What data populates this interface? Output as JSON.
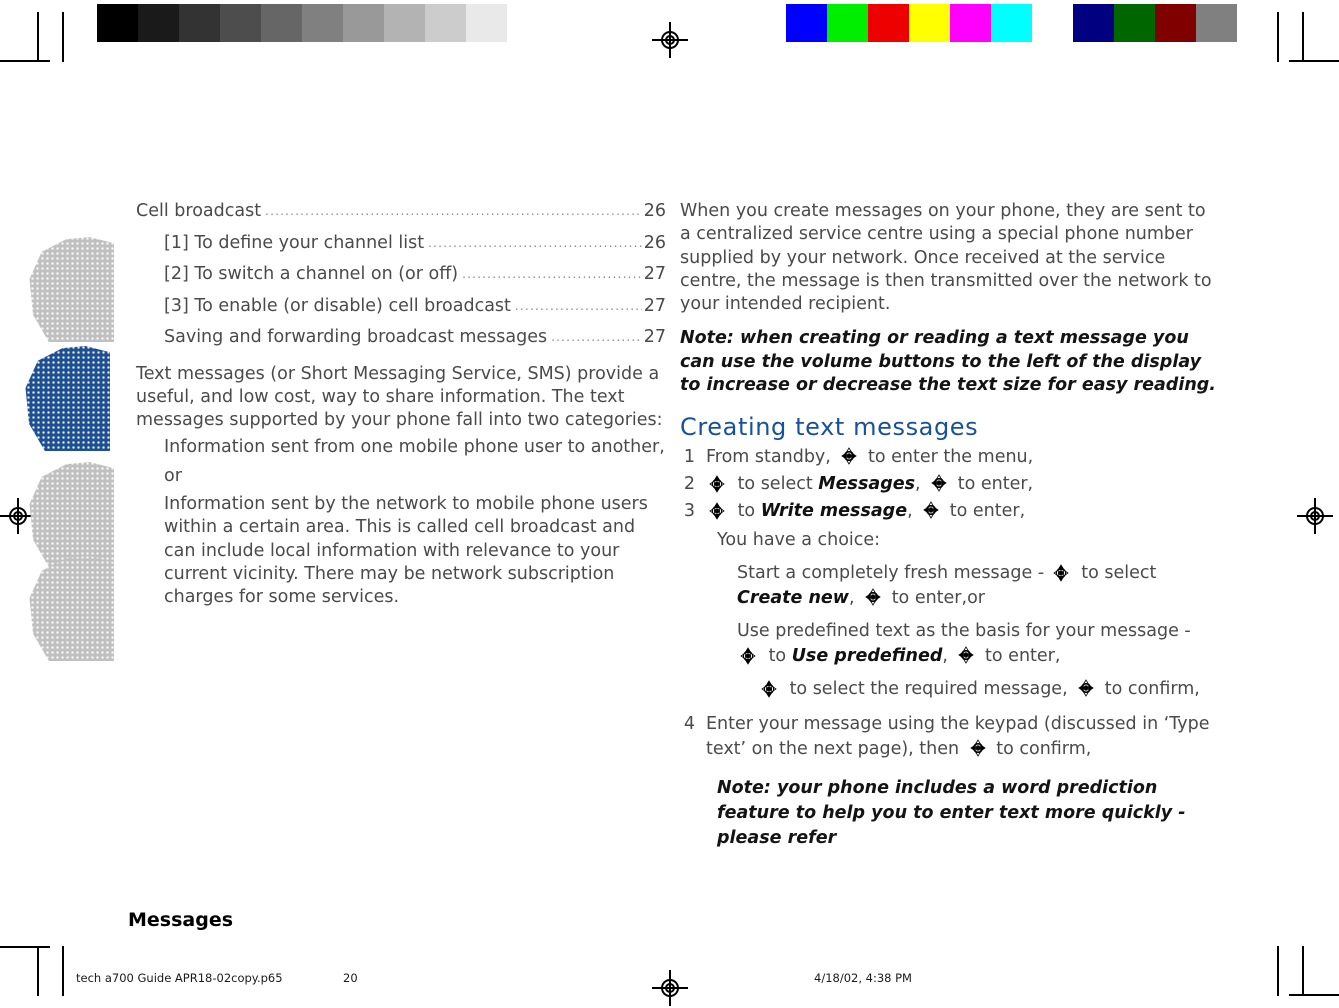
{
  "page": {
    "number": "20",
    "chapter": "Messages"
  },
  "calibration": {
    "gray_wedge": [
      "#000000",
      "#1a1a1a",
      "#333333",
      "#4d4d4d",
      "#666666",
      "#808080",
      "#999999",
      "#b3b3b3",
      "#cccccc",
      "#e9e9e9",
      "#ffffff"
    ],
    "color_bars": [
      "#0000ff",
      "#00ee00",
      "#ee0000",
      "#ffff00",
      "#ff00ff",
      "#00ffff",
      "#ffffff",
      "#000080",
      "#006600",
      "#800000",
      "#808080"
    ]
  },
  "tabs": {
    "active_color": "#1d4f91",
    "inactive_color": "#c0c0c0"
  },
  "toc": [
    {
      "label": "Cell broadcast",
      "page": "26",
      "indent": false
    },
    {
      "label": "[1] To define your channel list",
      "page": "26",
      "indent": true
    },
    {
      "label": "[2] To switch a channel on (or off)",
      "page": "27",
      "indent": true
    },
    {
      "label": "[3] To enable (or disable) cell broadcast",
      "page": "27",
      "indent": true
    },
    {
      "label": "Saving and forwarding broadcast messages",
      "page": "27",
      "indent": true
    }
  ],
  "left_column": {
    "intro": "Text messages (or Short Messaging Service, SMS) provide a useful, and low cost, way to share information. The text messages supported by your phone fall into two categories:",
    "bullet_one": "Information sent from one mobile phone user to another,",
    "bullet_or": "or",
    "bullet_two": "Information sent by the network to mobile phone users within a certain area. This is called cell broadcast and can include local information with relevance to your current vicinity. There may be network subscription charges for some services."
  },
  "right_column": {
    "intro": "When you create messages on your phone, they are sent to a centralized service centre using a special phone number supplied by your network. Once received at the service centre, the message is then transmitted over the network to your intended recipient.",
    "note_top": "Note: when creating or reading a text message you can use the volume buttons to the left of the display to increase or decrease the text size for easy reading.",
    "heading": "Creating text messages",
    "steps": [
      {
        "num": "1",
        "parts": [
          {
            "t": "text",
            "v": "From standby, "
          },
          {
            "t": "navkey",
            "v": "navkey-horizontal"
          },
          {
            "t": "text",
            "v": " to enter the menu,"
          }
        ]
      },
      {
        "num": "2",
        "parts": [
          {
            "t": "navkey",
            "v": "navkey-vertical"
          },
          {
            "t": "text",
            "v": " to select "
          },
          {
            "t": "menu",
            "v": "Messages"
          },
          {
            "t": "text",
            "v": ", "
          },
          {
            "t": "navkey",
            "v": "navkey-horizontal"
          },
          {
            "t": "text",
            "v": " to enter,"
          }
        ]
      },
      {
        "num": "3",
        "parts": [
          {
            "t": "navkey",
            "v": "navkey-vertical"
          },
          {
            "t": "text",
            "v": " to "
          },
          {
            "t": "menu",
            "v": "Write message"
          },
          {
            "t": "text",
            "v": ",  "
          },
          {
            "t": "navkey",
            "v": "navkey-horizontal"
          },
          {
            "t": "text",
            "v": " to enter,"
          }
        ]
      }
    ],
    "choice_intro": "You have a choice:",
    "choice_one": {
      "lead": "Start a completely fresh message - ",
      "key1": "navkey-vertical",
      "mid": " to select ",
      "menu": "Create new",
      "mid2": ",  ",
      "key2": "navkey-horizontal",
      "tail": " to enter,or"
    },
    "choice_two": {
      "lead": "Use predefined text as the basis for your message - ",
      "key1": "navkey-vertical",
      "mid": " to ",
      "menu": "Use predefined",
      "mid2": ", ",
      "key2": "navkey-horizontal",
      "tail": " to enter,"
    },
    "choice_two_sub": {
      "key1": "navkey-vertical",
      "mid": " to select the required message, ",
      "key2": "navkey-horizontal",
      "tail": " to confirm,"
    },
    "step_four": {
      "num": "4",
      "lead": "Enter your message using the keypad (discussed in ‘Type text’ on the next page), then ",
      "key": "navkey-horizontal",
      "tail": " to confirm,"
    },
    "note_bottom": "Note: your phone includes a word prediction feature to help you to enter text more quickly - please refer"
  },
  "printline": {
    "file": "tech a700 Guide APR18-02copy.p65",
    "page": "20",
    "timestamp": "4/18/02, 4:38 PM"
  }
}
